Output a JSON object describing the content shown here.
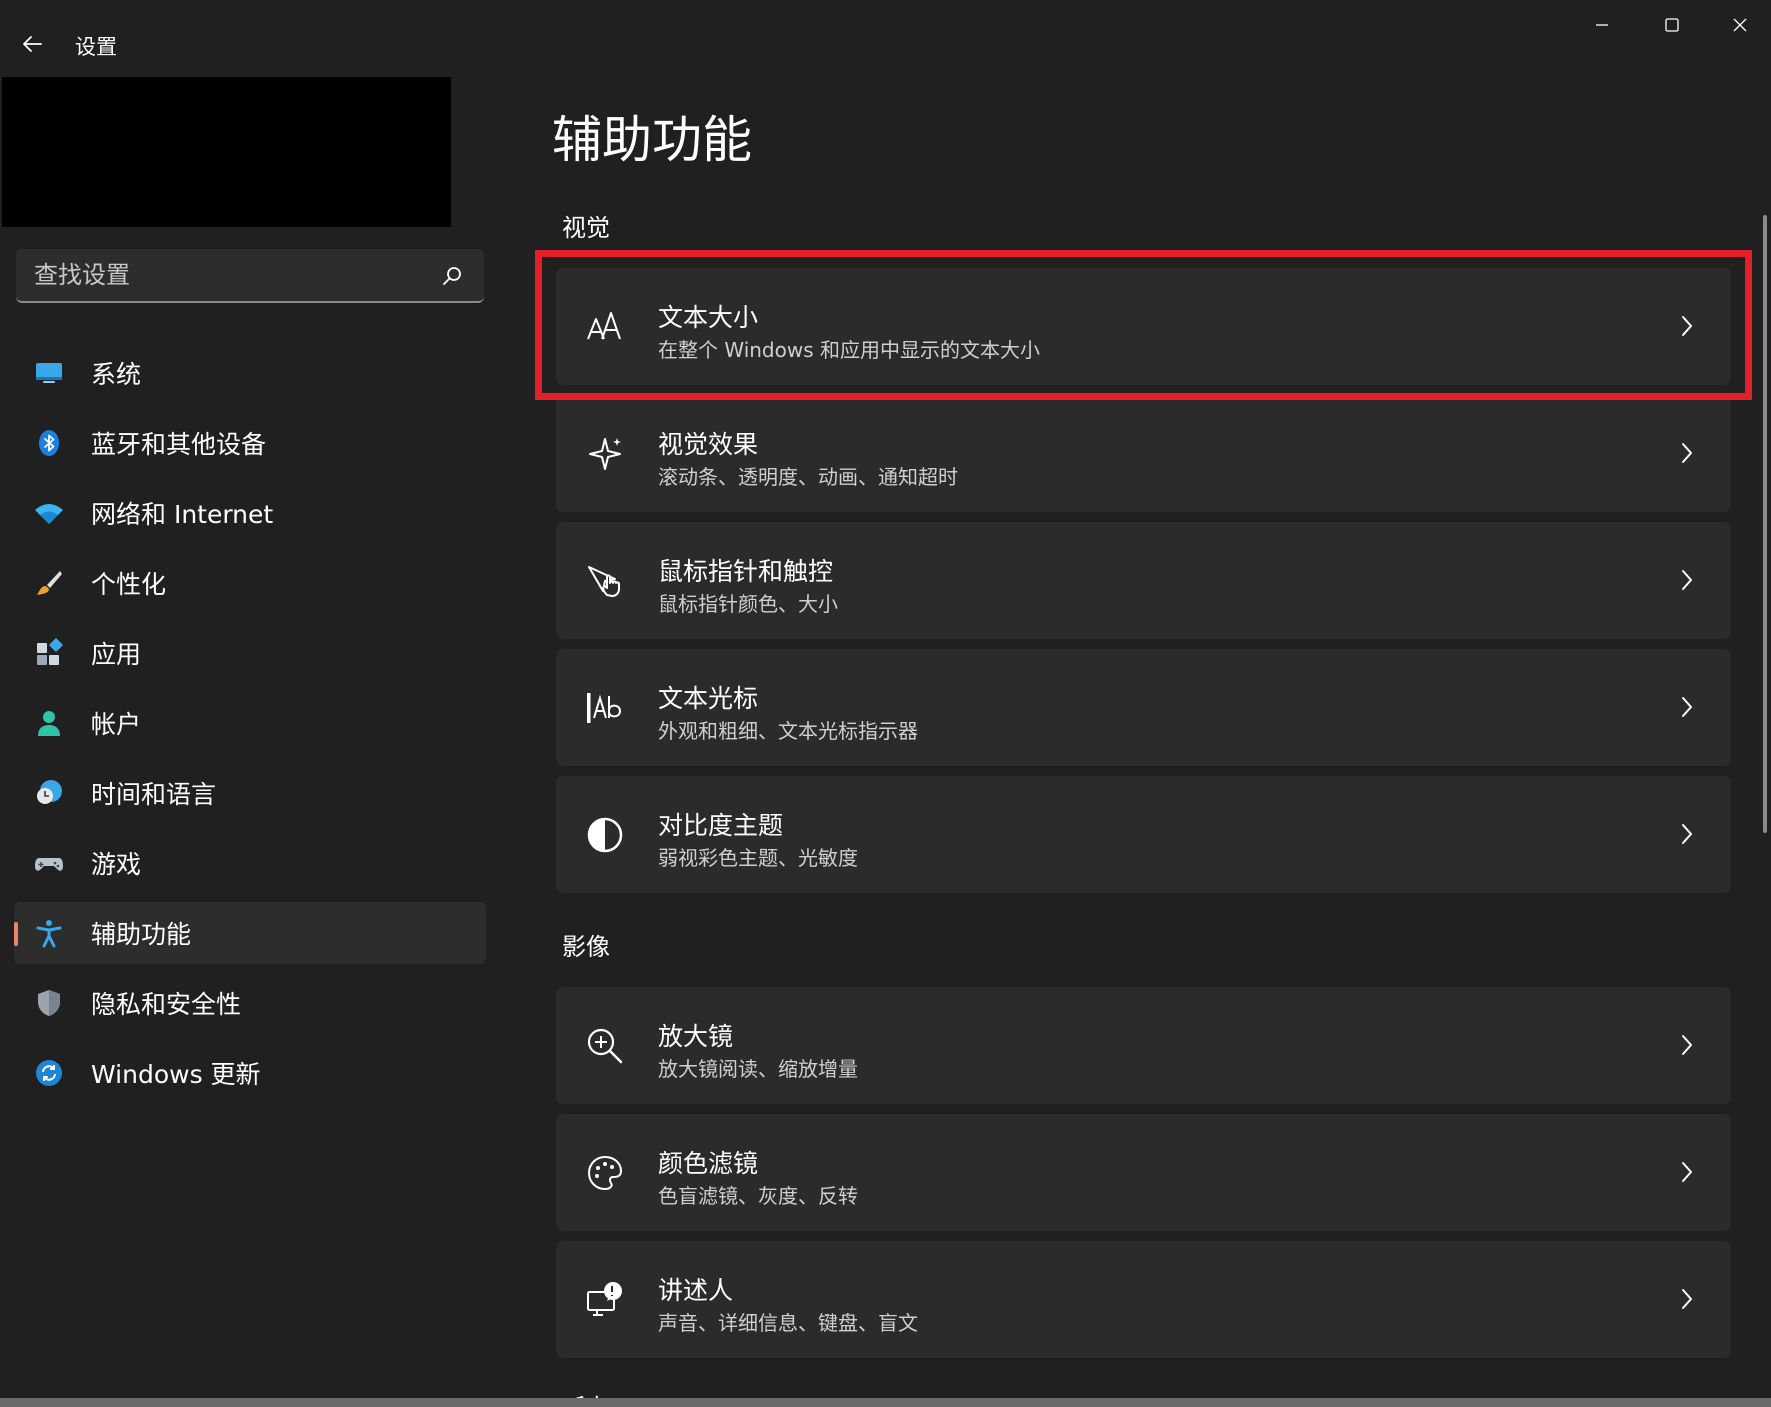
{
  "window": {
    "title": "设置",
    "controls": [
      "minimize",
      "maximize",
      "close"
    ]
  },
  "search": {
    "placeholder": "查找设置"
  },
  "sidebar": {
    "items": [
      {
        "label": "系统",
        "icon": "system-icon",
        "active": false
      },
      {
        "label": "蓝牙和其他设备",
        "icon": "bluetooth-icon",
        "active": false
      },
      {
        "label": "网络和 Internet",
        "icon": "wifi-icon",
        "active": false
      },
      {
        "label": "个性化",
        "icon": "brush-icon",
        "active": false
      },
      {
        "label": "应用",
        "icon": "apps-icon",
        "active": false
      },
      {
        "label": "帐户",
        "icon": "account-icon",
        "active": false
      },
      {
        "label": "时间和语言",
        "icon": "time-language-icon",
        "active": false
      },
      {
        "label": "游戏",
        "icon": "gamepad-icon",
        "active": false
      },
      {
        "label": "辅助功能",
        "icon": "accessibility-icon",
        "active": true
      },
      {
        "label": "隐私和安全性",
        "icon": "shield-icon",
        "active": false
      },
      {
        "label": "Windows 更新",
        "icon": "update-icon",
        "active": false
      }
    ]
  },
  "main": {
    "title": "辅助功能",
    "sections": [
      {
        "title": "视觉",
        "cards": [
          {
            "title": "文本大小",
            "subtitle": "在整个 Windows 和应用中显示的文本大小",
            "icon": "text-size-icon",
            "highlighted": true
          },
          {
            "title": "视觉效果",
            "subtitle": "滚动条、透明度、动画、通知超时",
            "icon": "sparkle-icon",
            "highlighted": false
          },
          {
            "title": "鼠标指针和触控",
            "subtitle": "鼠标指针颜色、大小",
            "icon": "pointer-touch-icon",
            "highlighted": false
          },
          {
            "title": "文本光标",
            "subtitle": "外观和粗细、文本光标指示器",
            "icon": "text-cursor-icon",
            "highlighted": false
          },
          {
            "title": "对比度主题",
            "subtitle": "弱视彩色主题、光敏度",
            "icon": "contrast-icon",
            "highlighted": false
          }
        ]
      },
      {
        "title": "影像",
        "cards": [
          {
            "title": "放大镜",
            "subtitle": "放大镜阅读、缩放增量",
            "icon": "magnifier-icon",
            "highlighted": false
          },
          {
            "title": "颜色滤镜",
            "subtitle": "色盲滤镜、灰度、反转",
            "icon": "palette-icon",
            "highlighted": false
          },
          {
            "title": "讲述人",
            "subtitle": "声音、详细信息、键盘、盲文",
            "icon": "narrator-icon",
            "highlighted": false
          }
        ]
      }
    ],
    "next_section_partial": "听力"
  },
  "colors": {
    "background": "#202020",
    "card": "#2b2b2b",
    "active_indicator": "#f0826a",
    "highlight_box": "#e3202a"
  }
}
